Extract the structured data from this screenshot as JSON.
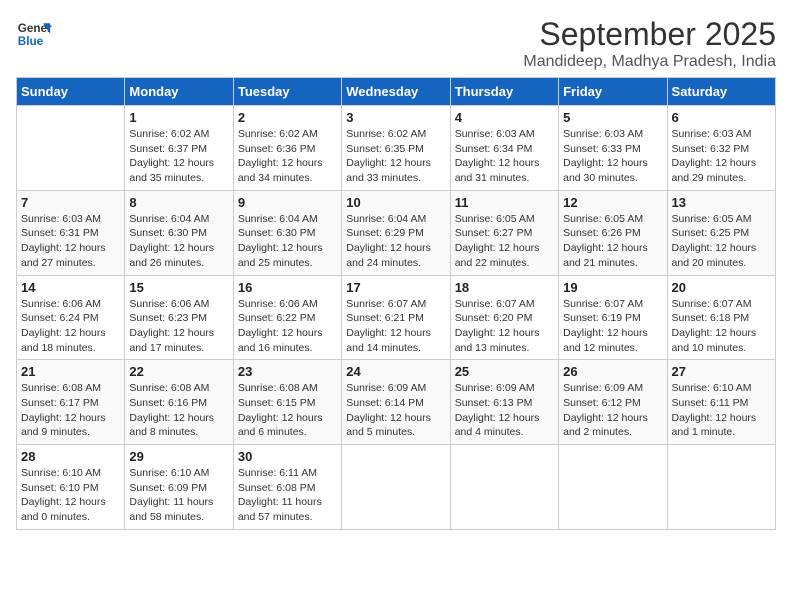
{
  "logo": {
    "line1": "General",
    "line2": "Blue"
  },
  "title": "September 2025",
  "location": "Mandideep, Madhya Pradesh, India",
  "days_of_week": [
    "Sunday",
    "Monday",
    "Tuesday",
    "Wednesday",
    "Thursday",
    "Friday",
    "Saturday"
  ],
  "weeks": [
    [
      {
        "day": "",
        "info": ""
      },
      {
        "day": "1",
        "info": "Sunrise: 6:02 AM\nSunset: 6:37 PM\nDaylight: 12 hours\nand 35 minutes."
      },
      {
        "day": "2",
        "info": "Sunrise: 6:02 AM\nSunset: 6:36 PM\nDaylight: 12 hours\nand 34 minutes."
      },
      {
        "day": "3",
        "info": "Sunrise: 6:02 AM\nSunset: 6:35 PM\nDaylight: 12 hours\nand 33 minutes."
      },
      {
        "day": "4",
        "info": "Sunrise: 6:03 AM\nSunset: 6:34 PM\nDaylight: 12 hours\nand 31 minutes."
      },
      {
        "day": "5",
        "info": "Sunrise: 6:03 AM\nSunset: 6:33 PM\nDaylight: 12 hours\nand 30 minutes."
      },
      {
        "day": "6",
        "info": "Sunrise: 6:03 AM\nSunset: 6:32 PM\nDaylight: 12 hours\nand 29 minutes."
      }
    ],
    [
      {
        "day": "7",
        "info": "Sunrise: 6:03 AM\nSunset: 6:31 PM\nDaylight: 12 hours\nand 27 minutes."
      },
      {
        "day": "8",
        "info": "Sunrise: 6:04 AM\nSunset: 6:30 PM\nDaylight: 12 hours\nand 26 minutes."
      },
      {
        "day": "9",
        "info": "Sunrise: 6:04 AM\nSunset: 6:30 PM\nDaylight: 12 hours\nand 25 minutes."
      },
      {
        "day": "10",
        "info": "Sunrise: 6:04 AM\nSunset: 6:29 PM\nDaylight: 12 hours\nand 24 minutes."
      },
      {
        "day": "11",
        "info": "Sunrise: 6:05 AM\nSunset: 6:27 PM\nDaylight: 12 hours\nand 22 minutes."
      },
      {
        "day": "12",
        "info": "Sunrise: 6:05 AM\nSunset: 6:26 PM\nDaylight: 12 hours\nand 21 minutes."
      },
      {
        "day": "13",
        "info": "Sunrise: 6:05 AM\nSunset: 6:25 PM\nDaylight: 12 hours\nand 20 minutes."
      }
    ],
    [
      {
        "day": "14",
        "info": "Sunrise: 6:06 AM\nSunset: 6:24 PM\nDaylight: 12 hours\nand 18 minutes."
      },
      {
        "day": "15",
        "info": "Sunrise: 6:06 AM\nSunset: 6:23 PM\nDaylight: 12 hours\nand 17 minutes."
      },
      {
        "day": "16",
        "info": "Sunrise: 6:06 AM\nSunset: 6:22 PM\nDaylight: 12 hours\nand 16 minutes."
      },
      {
        "day": "17",
        "info": "Sunrise: 6:07 AM\nSunset: 6:21 PM\nDaylight: 12 hours\nand 14 minutes."
      },
      {
        "day": "18",
        "info": "Sunrise: 6:07 AM\nSunset: 6:20 PM\nDaylight: 12 hours\nand 13 minutes."
      },
      {
        "day": "19",
        "info": "Sunrise: 6:07 AM\nSunset: 6:19 PM\nDaylight: 12 hours\nand 12 minutes."
      },
      {
        "day": "20",
        "info": "Sunrise: 6:07 AM\nSunset: 6:18 PM\nDaylight: 12 hours\nand 10 minutes."
      }
    ],
    [
      {
        "day": "21",
        "info": "Sunrise: 6:08 AM\nSunset: 6:17 PM\nDaylight: 12 hours\nand 9 minutes."
      },
      {
        "day": "22",
        "info": "Sunrise: 6:08 AM\nSunset: 6:16 PM\nDaylight: 12 hours\nand 8 minutes."
      },
      {
        "day": "23",
        "info": "Sunrise: 6:08 AM\nSunset: 6:15 PM\nDaylight: 12 hours\nand 6 minutes."
      },
      {
        "day": "24",
        "info": "Sunrise: 6:09 AM\nSunset: 6:14 PM\nDaylight: 12 hours\nand 5 minutes."
      },
      {
        "day": "25",
        "info": "Sunrise: 6:09 AM\nSunset: 6:13 PM\nDaylight: 12 hours\nand 4 minutes."
      },
      {
        "day": "26",
        "info": "Sunrise: 6:09 AM\nSunset: 6:12 PM\nDaylight: 12 hours\nand 2 minutes."
      },
      {
        "day": "27",
        "info": "Sunrise: 6:10 AM\nSunset: 6:11 PM\nDaylight: 12 hours\nand 1 minute."
      }
    ],
    [
      {
        "day": "28",
        "info": "Sunrise: 6:10 AM\nSunset: 6:10 PM\nDaylight: 12 hours\nand 0 minutes."
      },
      {
        "day": "29",
        "info": "Sunrise: 6:10 AM\nSunset: 6:09 PM\nDaylight: 11 hours\nand 58 minutes."
      },
      {
        "day": "30",
        "info": "Sunrise: 6:11 AM\nSunset: 6:08 PM\nDaylight: 11 hours\nand 57 minutes."
      },
      {
        "day": "",
        "info": ""
      },
      {
        "day": "",
        "info": ""
      },
      {
        "day": "",
        "info": ""
      },
      {
        "day": "",
        "info": ""
      }
    ]
  ]
}
